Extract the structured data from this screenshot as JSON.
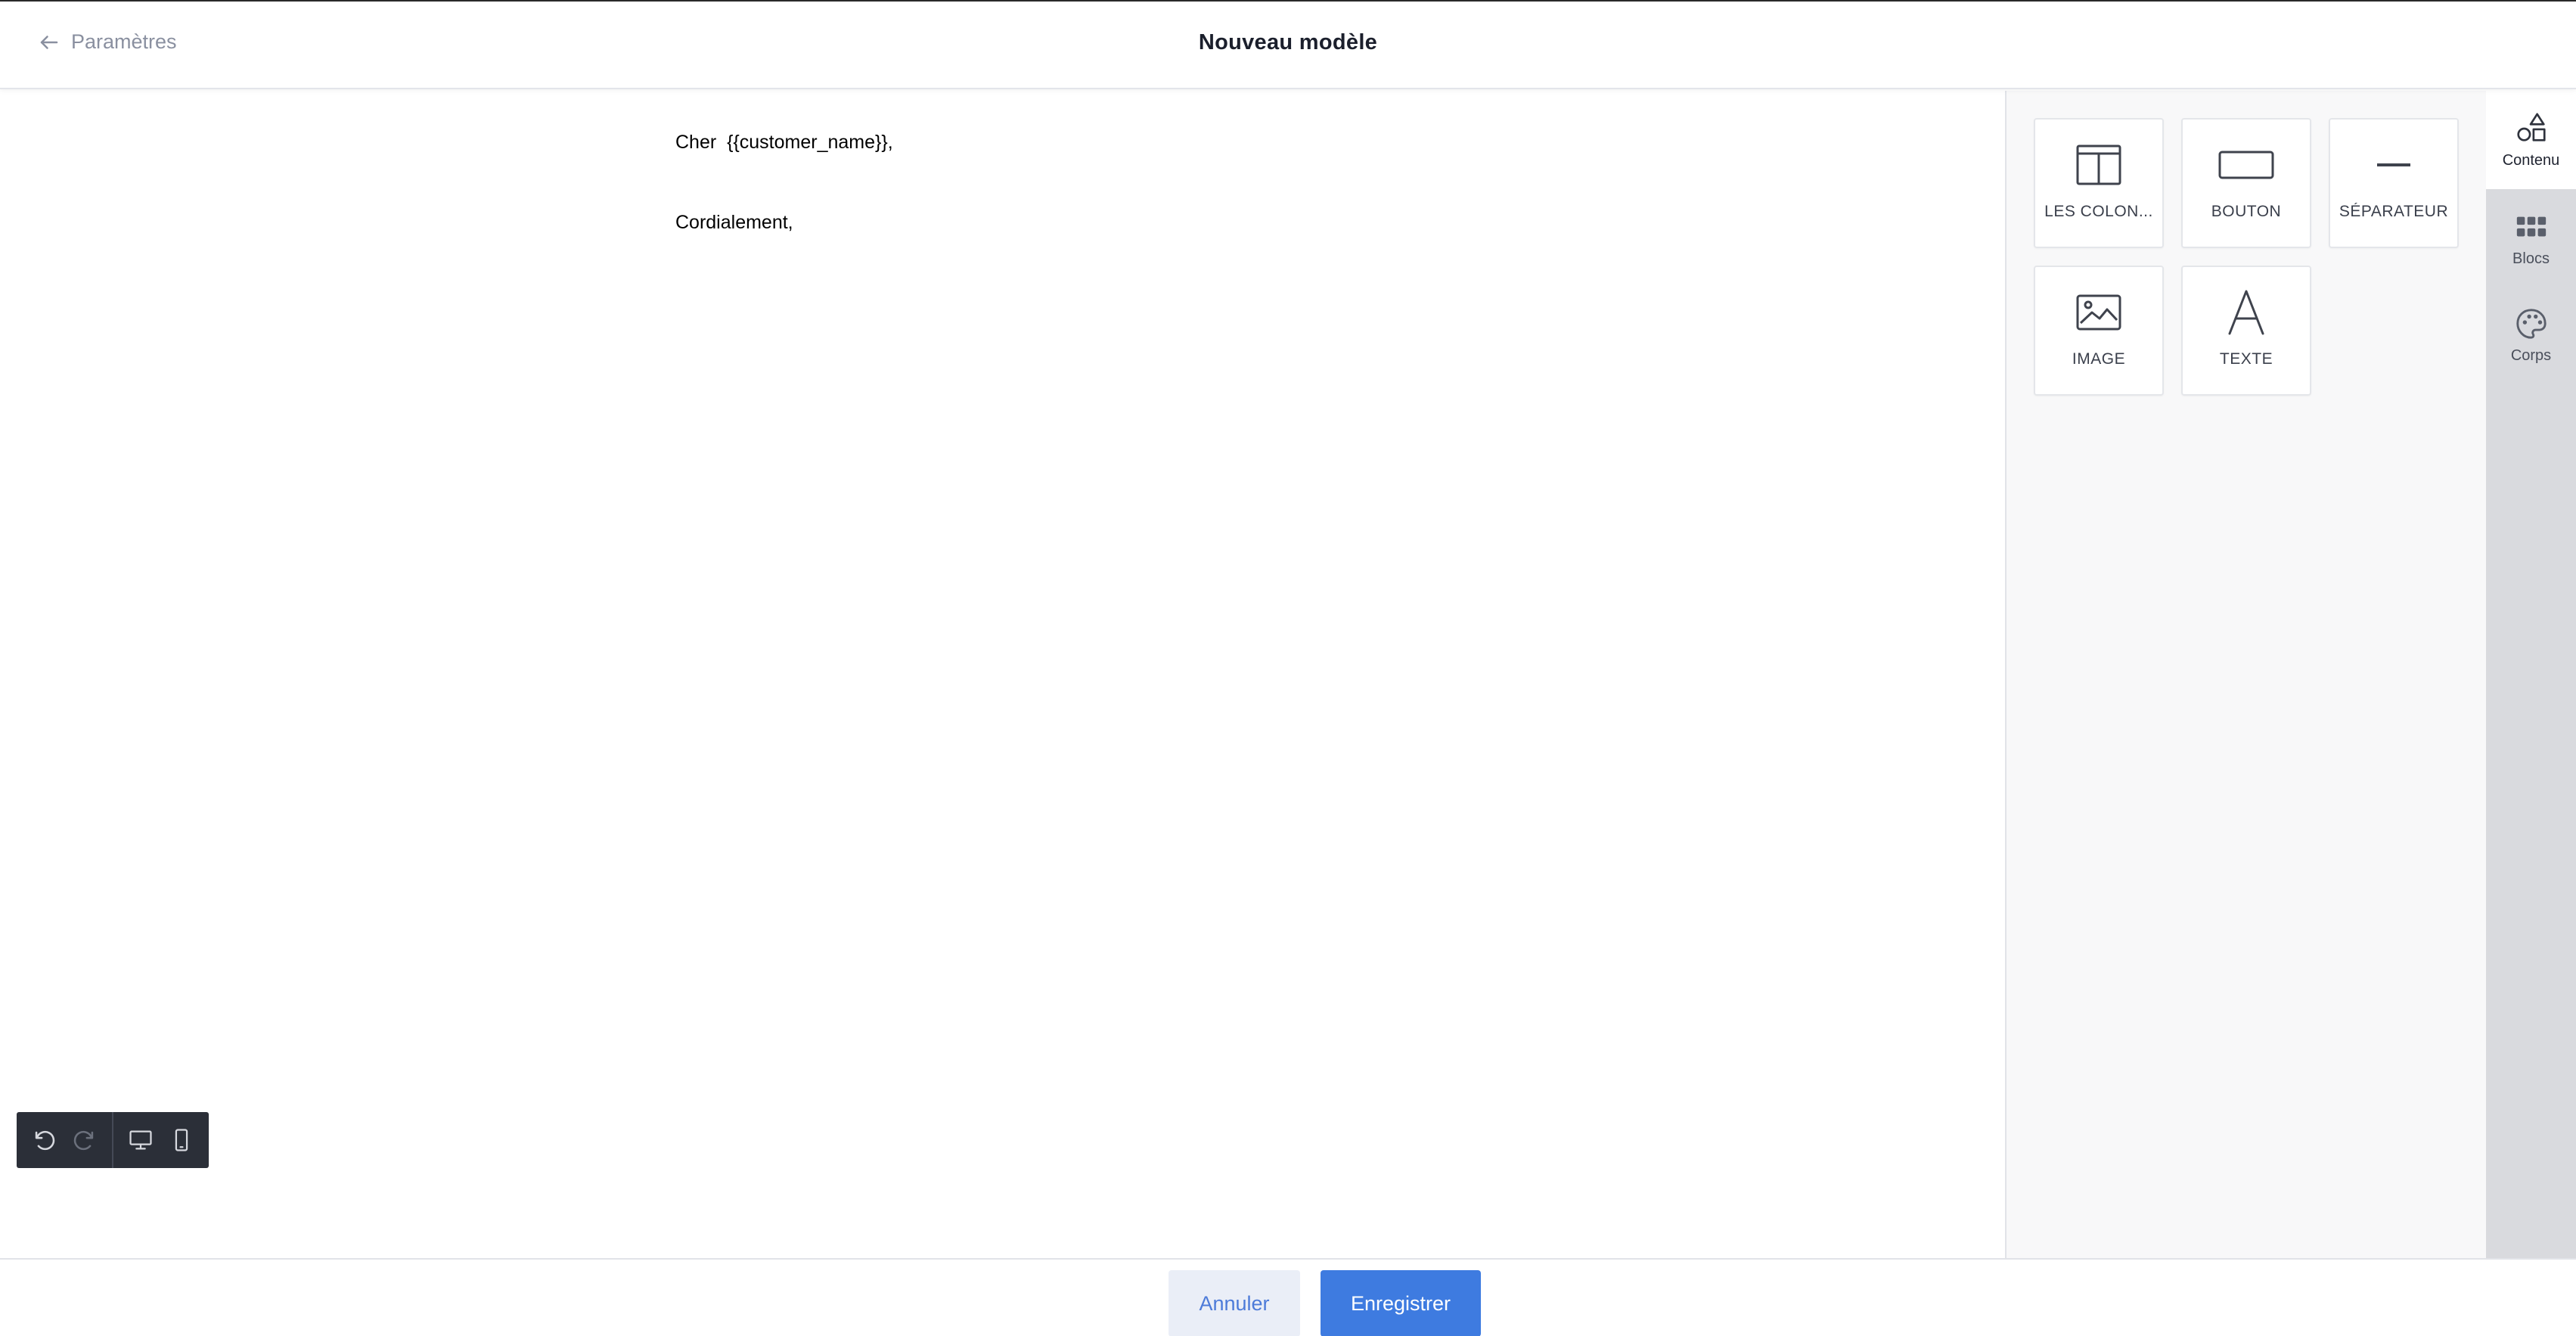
{
  "header": {
    "back_label": "Paramètres",
    "title": "Nouveau modèle"
  },
  "canvas": {
    "lines": [
      "Cher  {{customer_name}},",
      "Cordialement,"
    ]
  },
  "toolbar": {
    "icons": [
      "undo-icon",
      "redo-icon",
      "desktop-icon",
      "mobile-icon"
    ]
  },
  "panel": {
    "tiles": [
      {
        "label": "LES COLON...",
        "icon": "columns-icon"
      },
      {
        "label": "BOUTON",
        "icon": "button-icon"
      },
      {
        "label": "SÉPARATEUR",
        "icon": "divider-icon"
      },
      {
        "label": "IMAGE",
        "icon": "image-icon"
      },
      {
        "label": "TEXTE",
        "icon": "text-icon"
      }
    ]
  },
  "side_tabs": [
    {
      "label": "Contenu",
      "icon": "shapes-icon",
      "active": true
    },
    {
      "label": "Blocs",
      "icon": "grid-icon",
      "active": false
    },
    {
      "label": "Corps",
      "icon": "palette-icon",
      "active": false
    }
  ],
  "footer": {
    "cancel_label": "Annuler",
    "save_label": "Enregistrer"
  },
  "colors": {
    "primary": "#3e7be0",
    "cancel_bg": "#eaeef7",
    "toolbar_bg": "#2b2f38",
    "side_tabs_bg": "#d9dade",
    "panel_bg": "#f8f8f9"
  }
}
